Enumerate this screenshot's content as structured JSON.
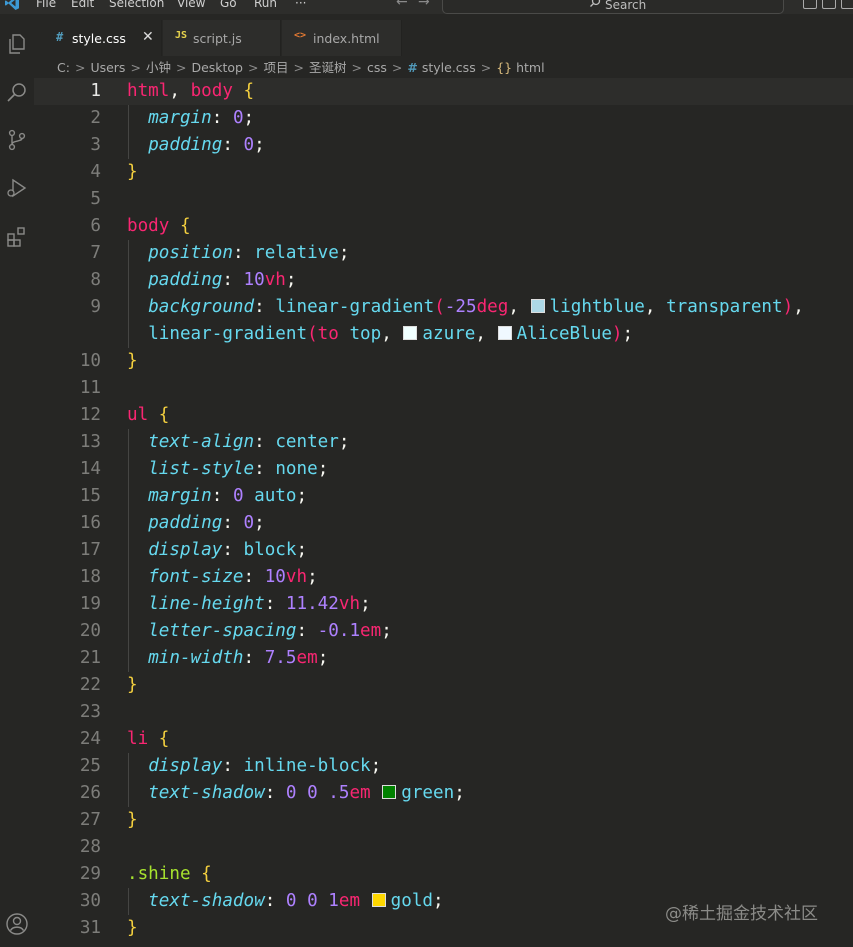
{
  "menu": {
    "items": [
      "File",
      "Edit",
      "Selection",
      "View",
      "Go",
      "Run",
      "···"
    ],
    "search_label": "Search",
    "back_arrow": "←",
    "forward_arrow": "→"
  },
  "tabs": [
    {
      "icon": "#",
      "icon_color": "#519aba",
      "label": "style.css",
      "close": "✕",
      "active": true
    },
    {
      "icon": "JS",
      "icon_color": "#e8d44d",
      "label": "script.js",
      "active": false
    },
    {
      "icon": "<>",
      "icon_color": "#e37933",
      "label": "index.html",
      "active": false
    }
  ],
  "breadcrumb": {
    "parts": [
      "C:",
      "Users",
      "小钟",
      "Desktop",
      "项目",
      "圣诞树",
      "css"
    ],
    "file_icon": "#",
    "file": "style.css",
    "symbol_icon": "{}",
    "symbol": "html",
    "separator": ">"
  },
  "editor": {
    "line_numbers": [
      "1",
      "2",
      "3",
      "4",
      "5",
      "6",
      "7",
      "8",
      "9",
      "",
      "10",
      "11",
      "12",
      "13",
      "14",
      "15",
      "16",
      "17",
      "18",
      "19",
      "20",
      "21",
      "22",
      "23",
      "24",
      "25",
      "26",
      "27",
      "28",
      "29",
      "30",
      "31"
    ],
    "current_line": "1"
  },
  "colors": {
    "lightblue": "#add8e6",
    "azure": "#f0ffff",
    "AliceBlue": "#f0f8ff",
    "green": "#008000",
    "gold": "#ffd700",
    "selector": "#f92672",
    "property": "#66d9ef",
    "number": "#ae81ff",
    "brace": "#f4d03f"
  },
  "watermark": "@稀土掘金技术社区"
}
